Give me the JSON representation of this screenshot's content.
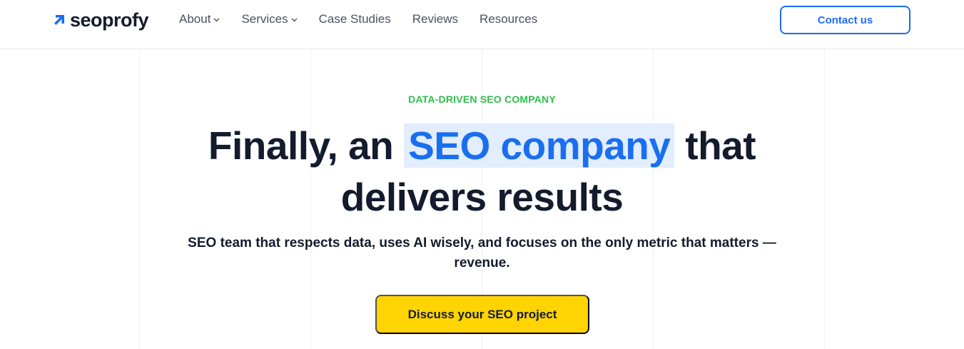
{
  "header": {
    "logo_text": "seoprofy",
    "logo_icon": "arrow-up-right-icon",
    "nav": [
      {
        "label": "About",
        "has_dropdown": true
      },
      {
        "label": "Services",
        "has_dropdown": true
      },
      {
        "label": "Case Studies",
        "has_dropdown": false
      },
      {
        "label": "Reviews",
        "has_dropdown": false
      },
      {
        "label": "Resources",
        "has_dropdown": false
      }
    ],
    "contact_label": "Contact us"
  },
  "hero": {
    "eyebrow": "DATA-DRIVEN SEO COMPANY",
    "headline_before": "Finally, an",
    "headline_highlight": "SEO company",
    "headline_after": "that",
    "headline_line2": "delivers results",
    "subtitle": "SEO team that respects data, uses AI wisely, and focuses on the only metric that matters — revenue.",
    "cta_label": "Discuss your SEO project"
  },
  "colors": {
    "brand_blue": "#1a6ef0",
    "eyebrow_green": "#2cbf4a",
    "cta_yellow": "#ffd400",
    "highlight_bg": "#e2edfd",
    "text_dark": "#141b2d"
  }
}
